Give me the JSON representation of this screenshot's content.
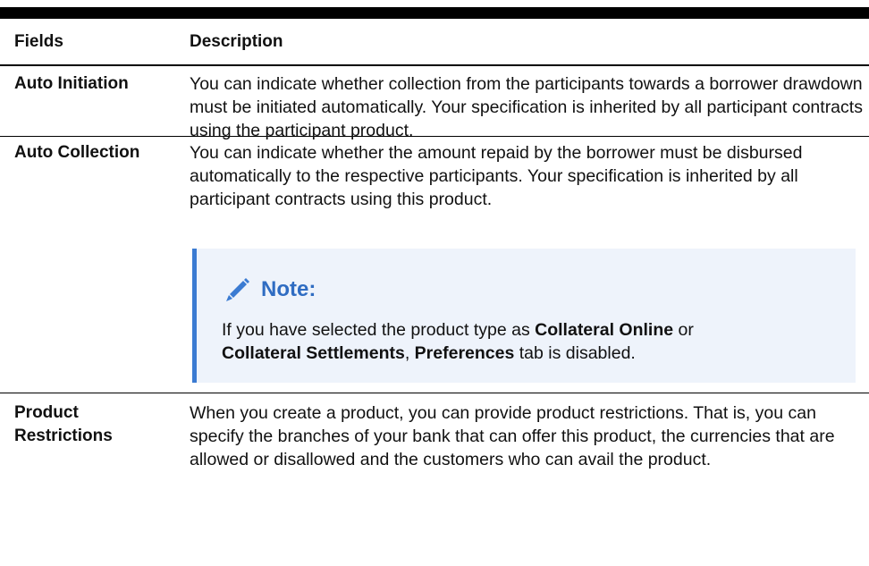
{
  "header": {
    "fields": "Fields",
    "description": "Description"
  },
  "rows": [
    {
      "field": "Auto Initiation",
      "description": "You can indicate whether collection from the participants towards a borrower drawdown must be initiated automatically. Your specification is inherited by all participant contracts using the participant product."
    },
    {
      "field": "Auto Collection",
      "description": "You can indicate whether the amount repaid by the borrower must be disbursed automatically to the respective participants. Your specification is inherited by all participant contracts using this product.",
      "note": {
        "title": "Note:",
        "text_1": "If you have selected the product type as ",
        "bold_1": "Collateral Online",
        "text_2": " or",
        "bold_2": "Collateral Settlements",
        "text_3": ", ",
        "bold_3": "Preferences",
        "text_4": " tab is disabled."
      }
    },
    {
      "field_line1": "Product",
      "field_line2": "Restrictions",
      "description": "When you create a product, you can provide product restrictions. That is, you can specify the branches of your bank that can offer this product, the currencies that are allowed or disallowed and the customers who can avail the product."
    }
  ],
  "icons": {
    "note": "pencil-icon"
  },
  "colors": {
    "note_accent": "#3b7bd2",
    "note_title": "#2f6cc2",
    "note_bg": "#eef3fb"
  }
}
